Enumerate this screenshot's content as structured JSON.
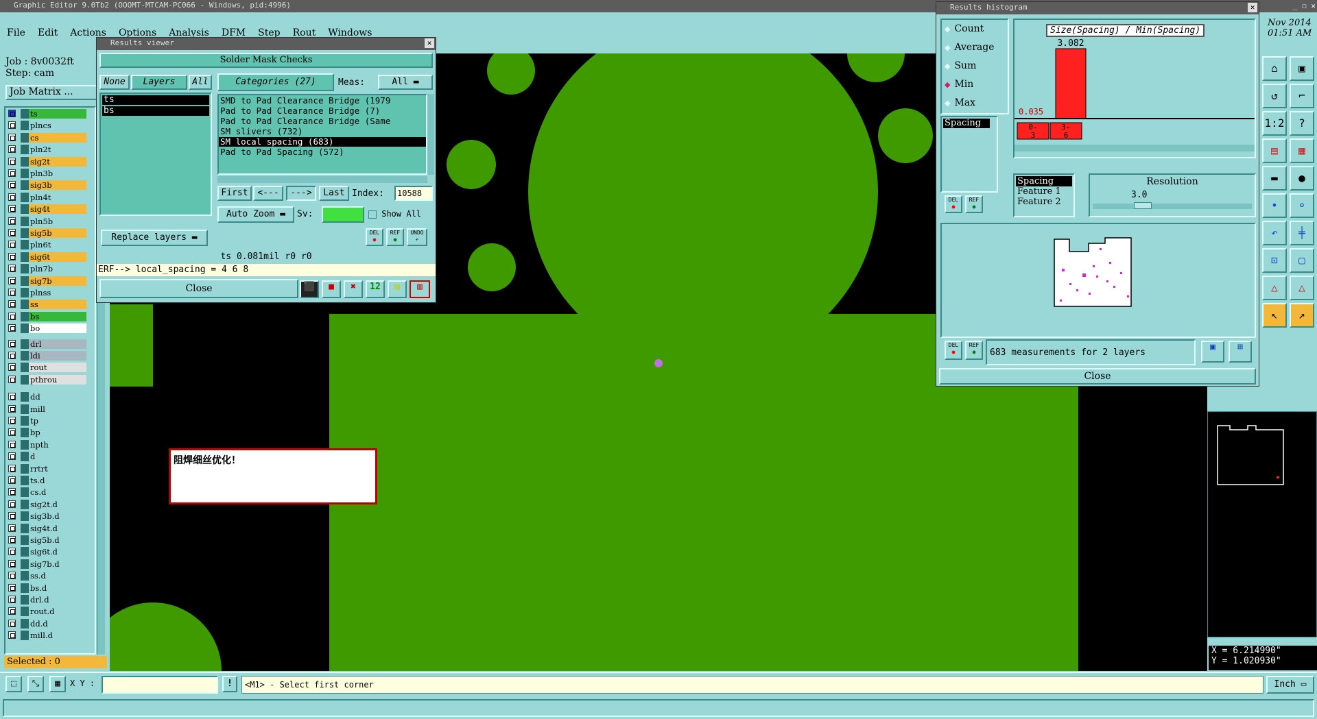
{
  "app": {
    "title": "Graphic Editor 9.0Tb2 (OOOMT-MTCAM-PC066 - Windows, pid:4996)",
    "menu": [
      "File",
      "Edit",
      "Actions",
      "Options",
      "Analysis",
      "DFM",
      "Step",
      "Rout",
      "Windows"
    ],
    "clock": {
      "date": "Nov 2014",
      "time": "01:51 AM"
    }
  },
  "job": {
    "job": "Job : 8v0032ft",
    "step": "Step: cam",
    "matrix_button": "Job Matrix ..."
  },
  "layers": [
    {
      "name": "ts",
      "color": "#38b838",
      "active": true
    },
    {
      "name": "plncs",
      "color": "#9ad8d8"
    },
    {
      "name": "cs",
      "color": "#f3b73a"
    },
    {
      "name": "pln2t",
      "color": "#9ad8d8"
    },
    {
      "name": "sig2t",
      "color": "#f3b73a"
    },
    {
      "name": "pln3b",
      "color": "#9ad8d8"
    },
    {
      "name": "sig3b",
      "color": "#f3b73a"
    },
    {
      "name": "pln4t",
      "color": "#9ad8d8"
    },
    {
      "name": "sig4t",
      "color": "#f3b73a"
    },
    {
      "name": "pln5b",
      "color": "#9ad8d8"
    },
    {
      "name": "sig5b",
      "color": "#f3b73a"
    },
    {
      "name": "pln6t",
      "color": "#9ad8d8"
    },
    {
      "name": "sig6t",
      "color": "#f3b73a"
    },
    {
      "name": "pln7b",
      "color": "#9ad8d8"
    },
    {
      "name": "sig7b",
      "color": "#f3b73a"
    },
    {
      "name": "plnss",
      "color": "#9ad8d8"
    },
    {
      "name": "ss",
      "color": "#f3b73a"
    },
    {
      "name": "bs",
      "color": "#38b838"
    },
    {
      "name": "bo",
      "color": "#ffffff"
    },
    {
      "name": "drl",
      "color": "#a8b8c0"
    },
    {
      "name": "ldi",
      "color": "#a8b8c0"
    },
    {
      "name": "rout",
      "color": "#e0e0e0"
    },
    {
      "name": "pthrou",
      "color": "#e0e0e0"
    },
    {
      "name": "dd",
      "color": "#9ad8d8"
    },
    {
      "name": "mill",
      "color": "#9ad8d8"
    },
    {
      "name": "tp",
      "color": "#9ad8d8"
    },
    {
      "name": "bp",
      "color": "#9ad8d8"
    },
    {
      "name": "npth",
      "color": "#9ad8d8"
    },
    {
      "name": "d",
      "color": "#9ad8d8"
    },
    {
      "name": "rrtrt",
      "color": "#9ad8d8"
    },
    {
      "name": "ts.d",
      "color": "#9ad8d8"
    },
    {
      "name": "cs.d",
      "color": "#9ad8d8"
    },
    {
      "name": "sig2t.d",
      "color": "#9ad8d8"
    },
    {
      "name": "sig3b.d",
      "color": "#9ad8d8"
    },
    {
      "name": "sig4t.d",
      "color": "#9ad8d8"
    },
    {
      "name": "sig5b.d",
      "color": "#9ad8d8"
    },
    {
      "name": "sig6t.d",
      "color": "#9ad8d8"
    },
    {
      "name": "sig7b.d",
      "color": "#9ad8d8"
    },
    {
      "name": "ss.d",
      "color": "#9ad8d8"
    },
    {
      "name": "bs.d",
      "color": "#9ad8d8"
    },
    {
      "name": "drl.d",
      "color": "#9ad8d8"
    },
    {
      "name": "rout.d",
      "color": "#9ad8d8"
    },
    {
      "name": "dd.d",
      "color": "#9ad8d8"
    },
    {
      "name": "mill.d",
      "color": "#9ad8d8"
    }
  ],
  "selected": "Selected : 0",
  "results_viewer": {
    "title": "Results viewer",
    "header": "Solder Mask Checks",
    "btn_none": "None",
    "btn_layers": "Layers",
    "btn_all": "All",
    "layer_list": [
      "ts",
      "bs"
    ],
    "categories_label": "Categories (27)",
    "meas_label": "Meas:",
    "meas_value": "All",
    "categories": [
      "SMD to Pad Clearance Bridge (1979",
      "Pad to Pad Clearance Bridge (7)",
      "Pad to Pad Clearance Bridge (Same",
      "SM slivers (732)",
      "SM local spacing (683)",
      "Pad to Pad Spacing (572)"
    ],
    "selected_category": 4,
    "first": "First",
    "prev": "<---",
    "next": "--->",
    "last": "Last",
    "index_label": "Index:",
    "index_value": "10588",
    "auto_zoom": "Auto Zoom",
    "sv_label": "Sv:",
    "show_all": "Show All",
    "replace_layers": "Replace layers",
    "status": "ts 0.081mil  r0  r0",
    "erf": "ERF--> local_spacing = 4 6 8",
    "close": "Close"
  },
  "annotation": "阻焊细丝优化！",
  "histogram": {
    "title": "Results histogram",
    "modes": [
      "Count",
      "Average",
      "Sum",
      "Min",
      "Max"
    ],
    "selected_mode": "Min",
    "list_item": "Spacing",
    "chart_title": "Size(Spacing) / Min(Spacing)",
    "bar_value": "3.082",
    "min_value": "0.035",
    "bins": [
      "0-3",
      "3-6"
    ],
    "feature_list": [
      "Spacing",
      "Feature 1",
      "Feature 2"
    ],
    "resolution_label": "Resolution",
    "resolution_value": "3.0",
    "measurements": "683 measurements for 2 layers",
    "close": "Close",
    "del": "DEL",
    "ref": "REF"
  },
  "coords": {
    "x": "X = 6.214990\"",
    "y": "Y = 1.020930\""
  },
  "bottom": {
    "xy_label": "X Y :",
    "prompt": "<M1> - Select first corner",
    "units": "Inch"
  },
  "colors": {
    "board_green": "#3f9a00",
    "background": "#000000",
    "panel": "#9ad8d8",
    "histogram_bar": "#ff2020"
  }
}
